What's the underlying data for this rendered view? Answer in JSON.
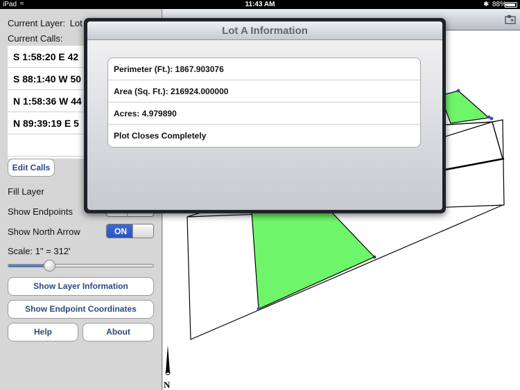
{
  "status_bar": {
    "device": "iPad",
    "time": "11:43 AM",
    "battery": "88%"
  },
  "sidebar": {
    "current_layer_label": "Current Layer:",
    "current_layer_value": "Lot",
    "current_calls_label": "Current Calls:",
    "calls": [
      "S 1:58:20 E 42",
      "S 88:1:40 W 50",
      "N 1:58:36 W 44",
      "N 89:39:19 E 5"
    ],
    "edit_calls_button": "Edit Calls",
    "fill_layer_label": "Fill Layer",
    "show_endpoints_label": "Show Endpoints",
    "show_north_arrow_label": "Show North Arrow",
    "north_arrow_toggle": "ON",
    "scale_label": "Scale: 1\" = 312'",
    "scale_slider_fraction": 0.28,
    "show_layer_info_button": "Show Layer Information",
    "show_endpoint_coords_button": "Show Endpoint Coordinates",
    "help_button": "Help",
    "about_button": "About"
  },
  "map": {
    "north_label": "N",
    "fill_color": "#6ff56a"
  },
  "popover": {
    "title": "Lot A Information",
    "rows": [
      "Perimeter (Ft.): 1867.903076",
      "Area (Sq. Ft.): 216924.000000",
      "Acres: 4.979890",
      "Plot Closes Completely"
    ]
  }
}
